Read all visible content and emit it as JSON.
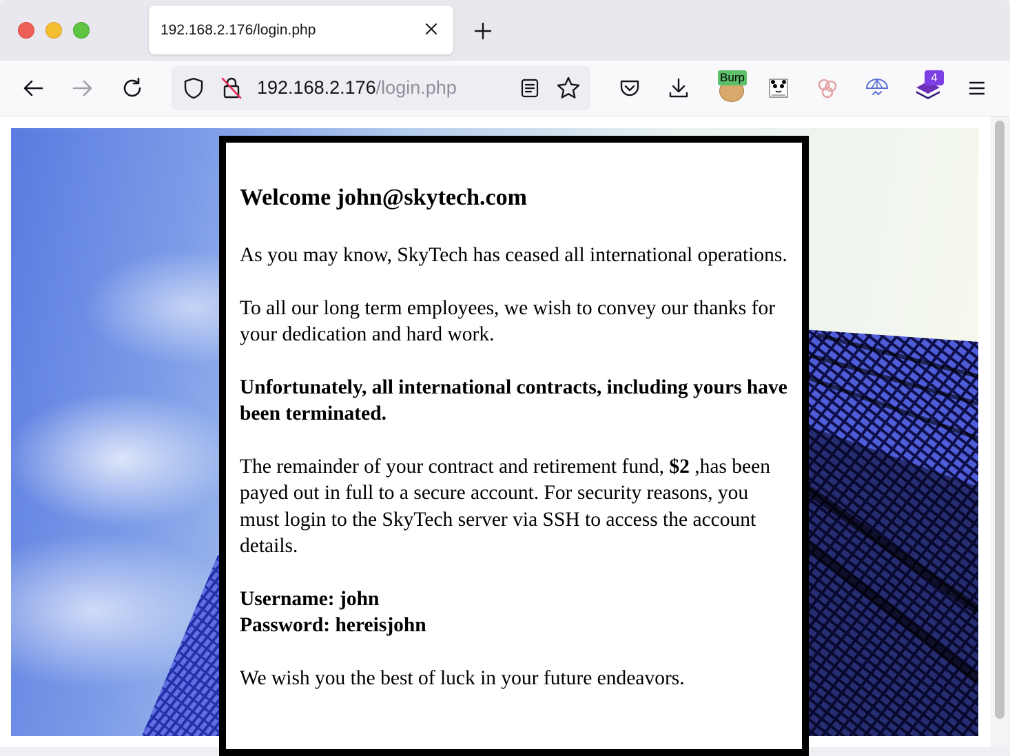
{
  "browser": {
    "tab_title": "192.168.2.176/login.php",
    "url_host": "192.168.2.176",
    "url_path": "/login.php",
    "extension_badge": "Burp",
    "notification_count": "4"
  },
  "page": {
    "heading": "Welcome john@skytech.com",
    "para1": "As you may know, SkyTech has ceased all international operations.",
    "para2": "To all our long term employees, we wish to convey our thanks for your dedication and hard work.",
    "para3": "Unfortunately, all international contracts, including yours have been terminated.",
    "para4_pre": "The remainder of your contract and retirement fund, ",
    "para4_amount": "$2",
    "para4_post": " ,has been payed out in full to a secure account. For security reasons, you must login to the SkyTech server via SSH to access the account details.",
    "username_line": "Username: john",
    "password_line": "Password: hereisjohn",
    "closing": "We wish you the best of luck in your future endeavors."
  }
}
